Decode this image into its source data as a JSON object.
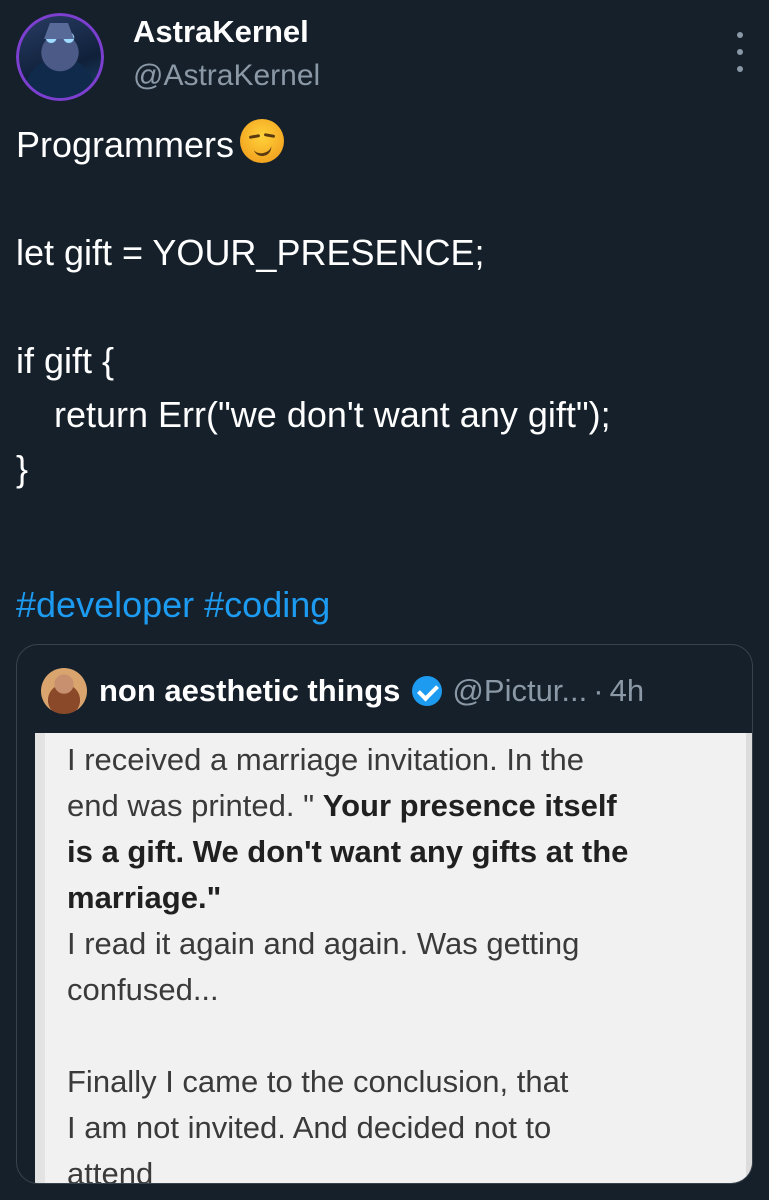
{
  "author": {
    "name": "AstraKernel",
    "handle": "@AstraKernel"
  },
  "tweet": {
    "lines": [
      "Programmers",
      "",
      "let gift = YOUR_PRESENCE;",
      "",
      "if gift {",
      "return Err(\"we don't want any gift\");",
      "}"
    ],
    "hashtags": [
      "#developer",
      "#coding"
    ]
  },
  "quoted": {
    "name": "non aesthetic things",
    "handle": "@Pictur...",
    "separator": "·",
    "time": "4h",
    "image_text": {
      "p1_a": "I received a marriage invitation. In the",
      "p1_b": "end was printed. \" ",
      "p1_bold_1": "Your presence itself",
      "p1_bold_2": "is a gift. We don't want any gifts at the",
      "p1_bold_3": "marriage.\"",
      "p2_a": "I read it again and again. Was getting",
      "p2_b": "confused...",
      "p3_a": "Finally I came to the conclusion, that",
      "p3_b": "I am not invited. And decided not to",
      "p3_c": "attend"
    }
  },
  "icons": [
    "more-icon",
    "smirk-emoji-icon",
    "verified-badge-icon"
  ]
}
